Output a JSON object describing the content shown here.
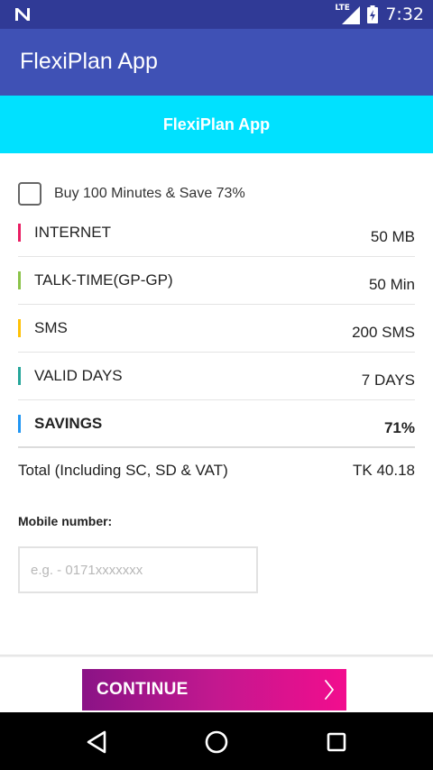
{
  "status_bar": {
    "network_label": "LTE",
    "time": "7:32"
  },
  "app_bar": {
    "title": "FlexiPlan App"
  },
  "banner": {
    "title": "FlexiPlan App"
  },
  "offer": {
    "checked": false,
    "label": "Buy 100 Minutes & Save 73%"
  },
  "plan_items": [
    {
      "label": "INTERNET",
      "value": "50 MB",
      "accent_color": "#e91e63"
    },
    {
      "label": "TALK-TIME(GP-GP)",
      "value": "50 Min",
      "accent_color": "#8bc34a"
    },
    {
      "label": "SMS",
      "value": "200 SMS",
      "accent_color": "#ffc107"
    },
    {
      "label": "VALID DAYS",
      "value": "7 DAYS",
      "accent_color": "#26a69a"
    },
    {
      "label": "SAVINGS",
      "value": "71%",
      "accent_color": "#2196f3"
    }
  ],
  "total": {
    "label": "Total (Including SC, SD & VAT)",
    "value": "TK 40.18"
  },
  "mobile": {
    "label": "Mobile number:",
    "value": "",
    "placeholder": "e.g. - 0171xxxxxxx"
  },
  "continue_button": {
    "label": "CONTINUE"
  },
  "colors": {
    "status_bar": "#303a96",
    "app_bar": "#3f51b5",
    "banner": "#00e1ff",
    "button_gradient_start": "#8a1386",
    "button_gradient_end": "#f20d8e"
  },
  "icons": {
    "status_left": "notification-n-icon",
    "signal": "signal-icon",
    "battery": "battery-icon",
    "continue": "chevron-right-icon",
    "nav_back": "back-triangle-icon",
    "nav_home": "home-circle-icon",
    "nav_recent": "recent-apps-square-icon"
  }
}
